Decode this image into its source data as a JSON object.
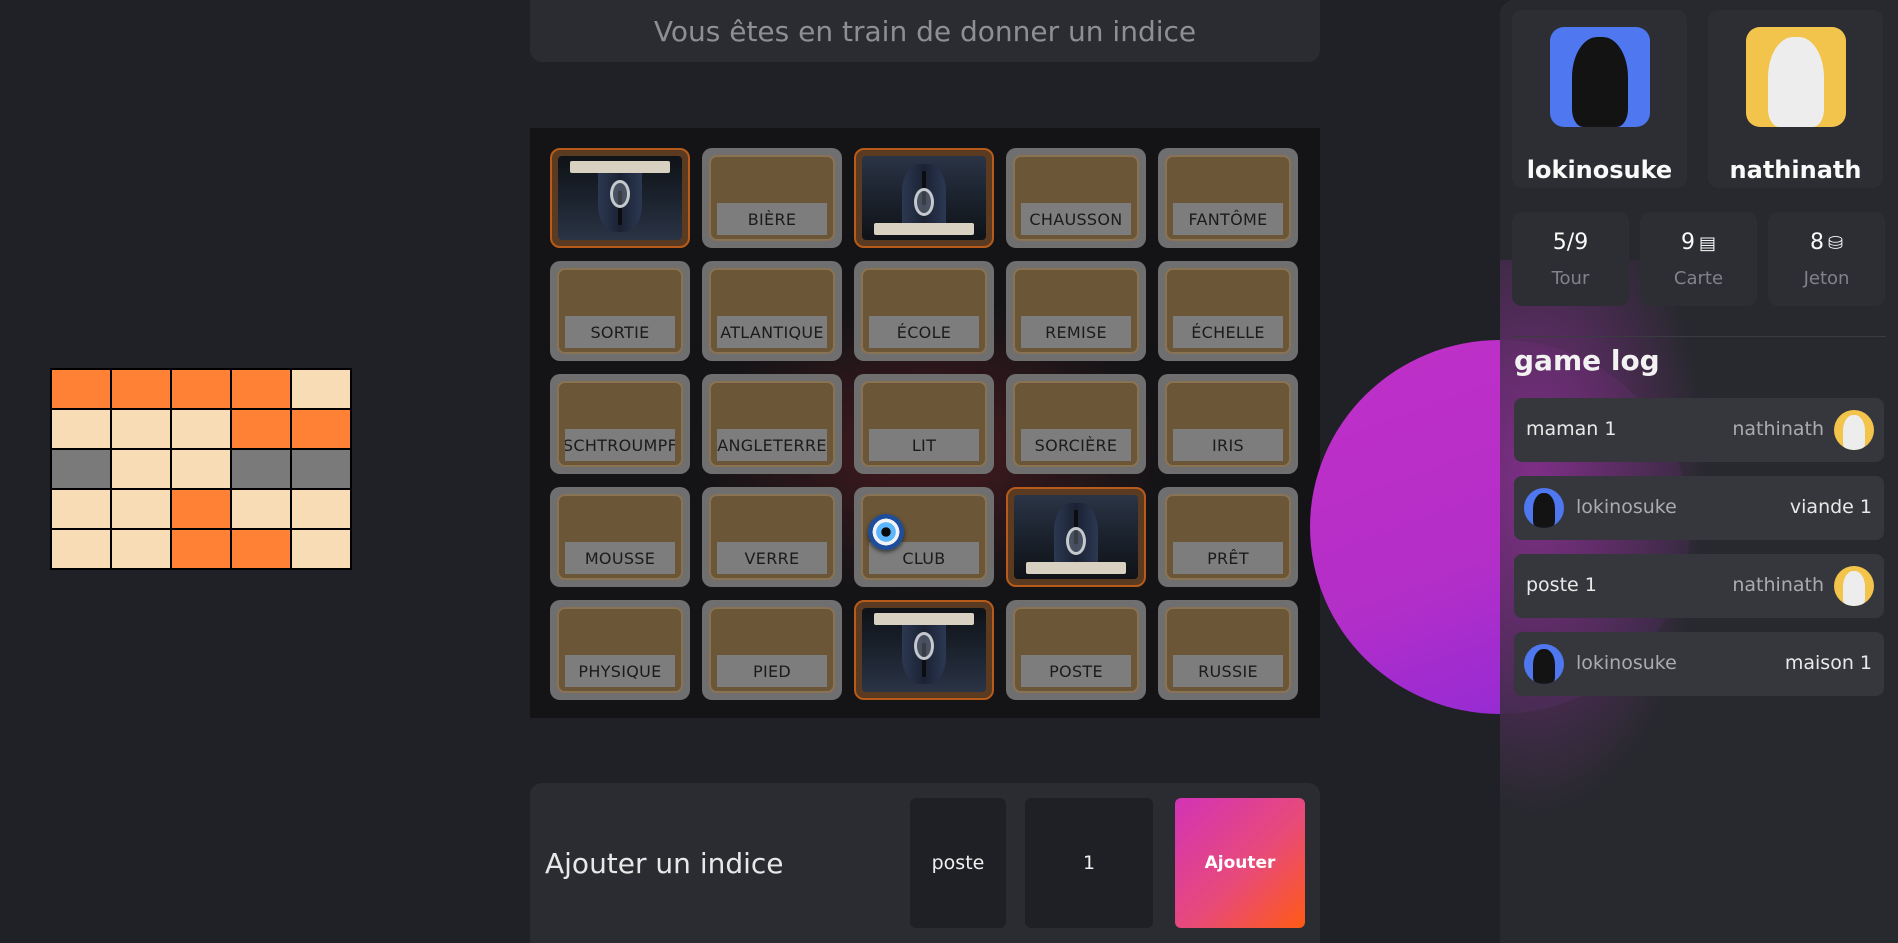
{
  "status": {
    "text": "Vous êtes en train de donner un indice"
  },
  "key_map": {
    "rows": [
      [
        "red",
        "red",
        "red",
        "red",
        "blue"
      ],
      [
        "blue",
        "blue",
        "blue",
        "red",
        "red"
      ],
      [
        "black",
        "blue",
        "blue",
        "black",
        "black"
      ],
      [
        "blue",
        "blue",
        "red",
        "blue",
        "blue"
      ],
      [
        "blue",
        "blue",
        "red",
        "red",
        "blue"
      ]
    ],
    "colors": {
      "red": "#ff8136",
      "blue": "#f7dcb5",
      "black": "#7a7a7a"
    }
  },
  "board": {
    "cards": [
      {
        "word": "",
        "revealed": true
      },
      {
        "word": "BIÈRE",
        "revealed": false
      },
      {
        "word": "",
        "revealed": true
      },
      {
        "word": "CHAUSSON",
        "revealed": false
      },
      {
        "word": "FANTÔME",
        "revealed": false
      },
      {
        "word": "SORTIE",
        "revealed": false
      },
      {
        "word": "ATLANTIQUE",
        "revealed": false
      },
      {
        "word": "ÉCOLE",
        "revealed": false
      },
      {
        "word": "REMISE",
        "revealed": false
      },
      {
        "word": "ÉCHELLE",
        "revealed": false
      },
      {
        "word": "SCHTROUMPF",
        "revealed": false
      },
      {
        "word": "ANGLETERRE",
        "revealed": false
      },
      {
        "word": "LIT",
        "revealed": false
      },
      {
        "word": "SORCIÈRE",
        "revealed": false
      },
      {
        "word": "IRIS",
        "revealed": false
      },
      {
        "word": "MOUSSE",
        "revealed": false
      },
      {
        "word": "VERRE",
        "revealed": false
      },
      {
        "word": "CLUB",
        "revealed": false
      },
      {
        "word": "",
        "revealed": true
      },
      {
        "word": "PRÊT",
        "revealed": false
      },
      {
        "word": "PHYSIQUE",
        "revealed": false
      },
      {
        "word": "PIED",
        "revealed": false
      },
      {
        "word": "",
        "revealed": true
      },
      {
        "word": "POSTE",
        "revealed": false
      },
      {
        "word": "RUSSIE",
        "revealed": false
      }
    ]
  },
  "clue_form": {
    "title": "Ajouter un indice",
    "word_value": "poste",
    "number_value": "1",
    "submit_label": "Ajouter"
  },
  "players": [
    {
      "name": "lokinosuke",
      "avatar_color": "#4f77f0"
    },
    {
      "name": "nathinath",
      "avatar_color": "#f3c44c"
    }
  ],
  "stats": [
    {
      "value": "5/9",
      "label": "Tour",
      "icon": ""
    },
    {
      "value": "9",
      "label": "Carte",
      "icon": "card-icon"
    },
    {
      "value": "8",
      "label": "Jeton",
      "icon": "coin-icon"
    }
  ],
  "game_log": {
    "title": "game log",
    "entries": [
      {
        "clue": "maman 1",
        "player": "nathinath",
        "side": "right"
      },
      {
        "clue": "viande 1",
        "player": "lokinosuke",
        "side": "left"
      },
      {
        "clue": "poste 1",
        "player": "nathinath",
        "side": "right"
      },
      {
        "clue": "maison 1",
        "player": "lokinosuke",
        "side": "left"
      }
    ]
  }
}
